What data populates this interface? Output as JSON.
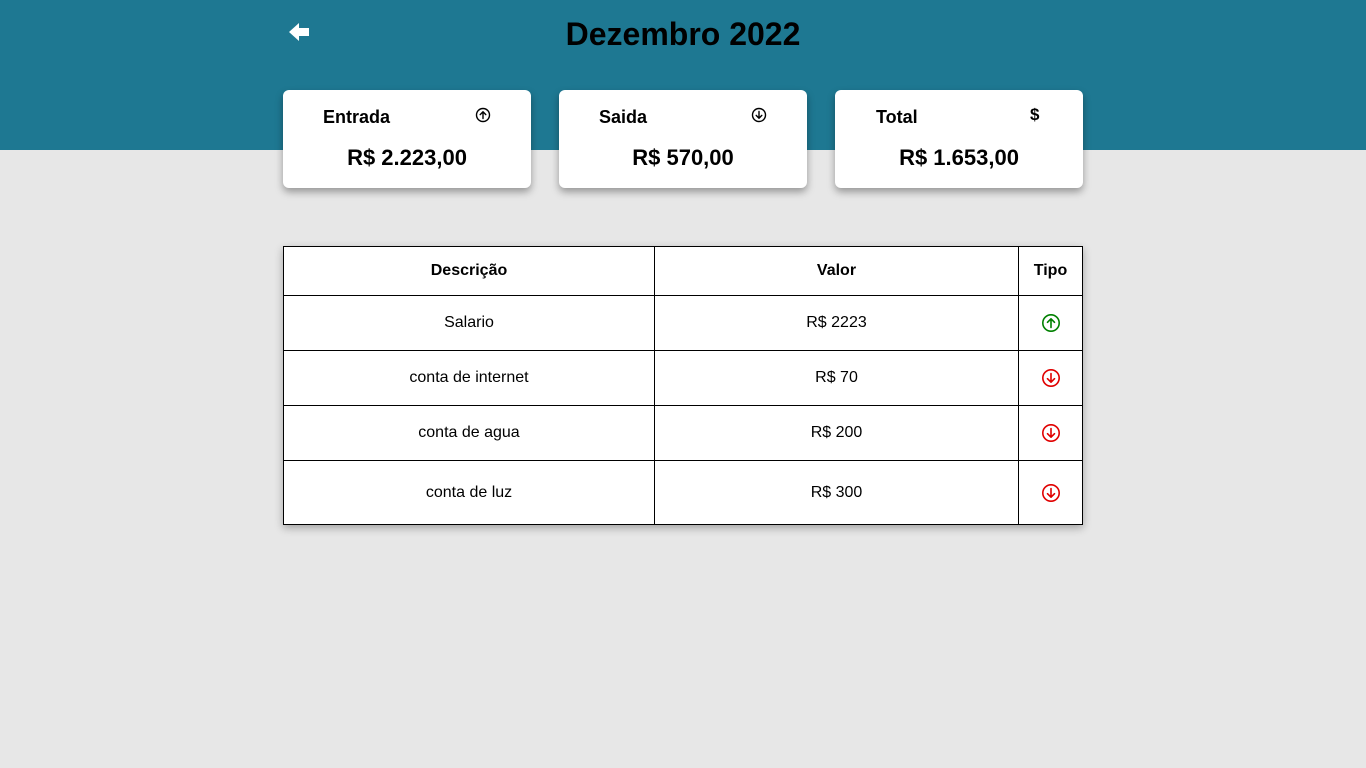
{
  "header": {
    "title": "Dezembro 2022",
    "back_icon": "arrow-left-icon",
    "background_color": "#1e7892"
  },
  "summary_cards": [
    {
      "label": "Entrada",
      "icon": "arrow-up-circle-icon",
      "value": "R$ 2.223,00"
    },
    {
      "label": "Saida",
      "icon": "arrow-down-circle-icon",
      "value": "R$ 570,00"
    },
    {
      "label": "Total",
      "icon": "$",
      "value": "R$ 1.653,00"
    }
  ],
  "table": {
    "columns": [
      "Descrição",
      "Valor",
      "Tipo"
    ],
    "rows": [
      {
        "description": "Salario",
        "value": "R$ 2223",
        "type": "entrada",
        "icon": "arrow-up-circle-icon",
        "color": "#008000"
      },
      {
        "description": "conta de internet",
        "value": "R$ 70",
        "type": "saida",
        "icon": "arrow-down-circle-icon",
        "color": "#e00000"
      },
      {
        "description": "conta de agua",
        "value": "R$ 200",
        "type": "saida",
        "icon": "arrow-down-circle-icon",
        "color": "#e00000"
      },
      {
        "description": "conta de luz",
        "value": "R$ 300",
        "type": "saida",
        "icon": "arrow-down-circle-icon",
        "color": "#e00000"
      }
    ]
  }
}
